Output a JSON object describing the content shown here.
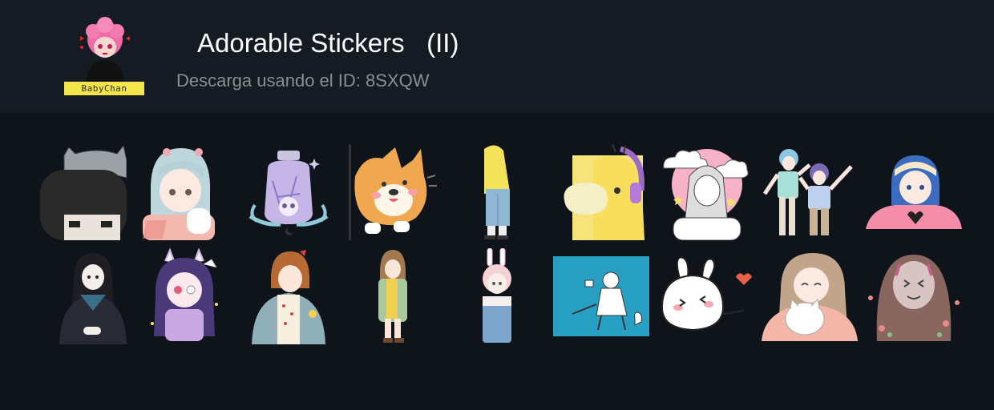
{
  "pack": {
    "title": "Adorable Stickers   (II)",
    "subtitle": "Descarga usando el ID: 8SXQW",
    "author_tag": "BabyChan"
  },
  "colors": {
    "page_background": "#0f141b",
    "header_background": "#151b23",
    "title_color": "#ffffff",
    "subtitle_color": "#8a8f96",
    "author_tag_background": "#f4e64a"
  },
  "stickers_row_1": [
    {
      "name": "girl-with-cat-on-head-sticker"
    },
    {
      "name": "silver-haired-girl-sticker"
    },
    {
      "name": "skull-jar-sticker"
    },
    {
      "name": "corgi-sticker"
    },
    {
      "name": "yellow-hoodie-person-sticker"
    },
    {
      "name": "psyduck-with-headphones-sticker"
    },
    {
      "name": "girl-with-clouds-sketch-sticker"
    },
    {
      "name": "dancing-boys-sticker"
    },
    {
      "name": "blue-haired-girl-heart-hands-sticker"
    }
  ],
  "stickers_row_2": [
    {
      "name": "girl-in-black-uniform-sticker"
    },
    {
      "name": "demon-horn-girl-sticker"
    },
    {
      "name": "girl-in-denim-jacket-sticker"
    },
    {
      "name": "girl-with-scarf-sticker"
    },
    {
      "name": "bunny-ear-girl-sticker"
    },
    {
      "name": "boy-crouching-on-blue-sticker"
    },
    {
      "name": "white-rabbit-heart-sticker"
    },
    {
      "name": "girl-hugging-cat-sticker"
    },
    {
      "name": "no-face-spirit-sticker"
    }
  ]
}
